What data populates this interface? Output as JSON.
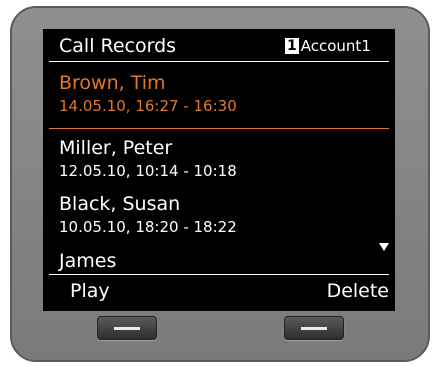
{
  "screen": {
    "title": "Call Records",
    "account_number": "1",
    "account_label": "Account1"
  },
  "records": [
    {
      "name": "Brown, Tim",
      "time": "14.05.10, 16:27 - 16:30",
      "selected": true
    },
    {
      "name": "Miller, Peter",
      "time": "12.05.10, 10:14 - 10:18",
      "selected": false
    },
    {
      "name": "Black, Susan",
      "time": "10.05.10, 18:20 - 18:22",
      "selected": false
    },
    {
      "name": "James",
      "time": "",
      "selected": false
    }
  ],
  "softkeys": {
    "left": "Play",
    "right": "Delete"
  },
  "colors": {
    "selected": "#e2782a",
    "screen_bg": "#000000",
    "text": "#ffffff"
  },
  "icons": [
    "scroll-down-icon",
    "softkey-bar-icon"
  ]
}
